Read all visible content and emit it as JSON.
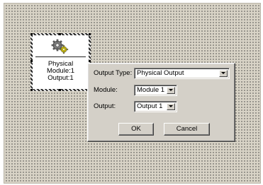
{
  "node": {
    "icon": "gears-icon",
    "lines": [
      "Physical",
      "Module:1",
      "Output:1"
    ]
  },
  "dialog": {
    "output_type_label": "Output Type:",
    "output_type_value": "Physical Output",
    "module_label": "Module:",
    "module_value": "Module 1",
    "output_label": "Output:",
    "output_value": "Output 1",
    "ok_label": "OK",
    "cancel_label": "Cancel"
  },
  "colors": {
    "canvas": "#d8d3c6",
    "dialog_face": "#d4d0c8"
  }
}
